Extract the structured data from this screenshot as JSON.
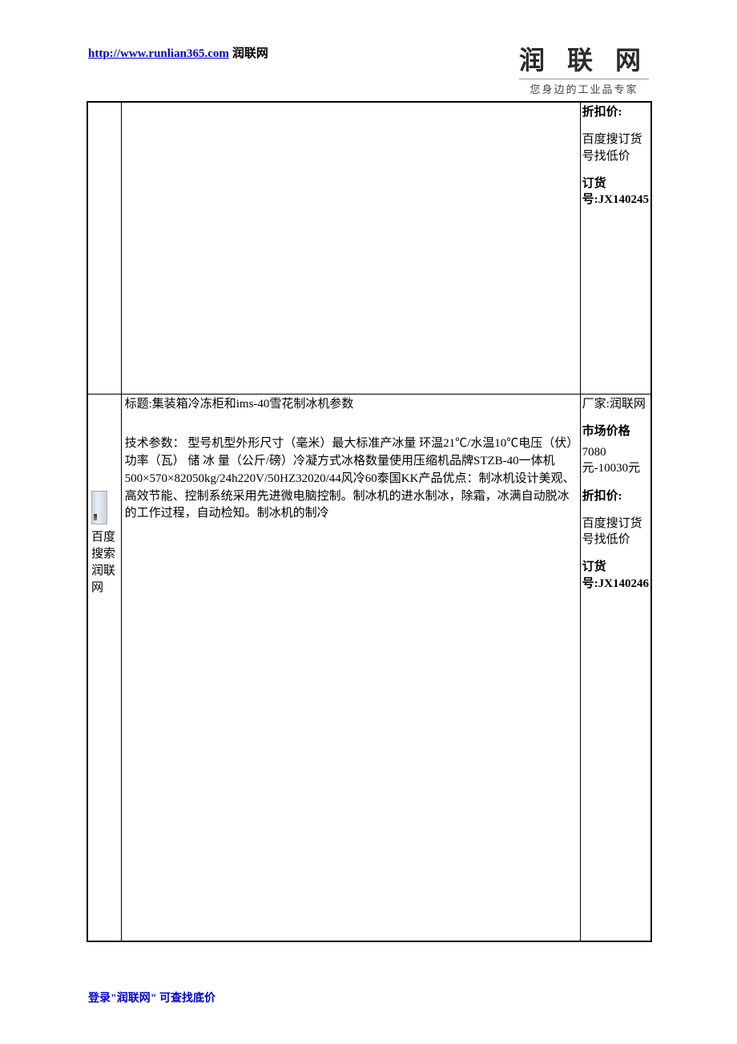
{
  "header": {
    "url": "http://www.runlian365.com",
    "url_suffix": "润联网",
    "logo_main": "润 联 网",
    "logo_sub": "您身边的工业品专家"
  },
  "row1": {
    "left": "",
    "mid": "",
    "right": {
      "discount_label": "折扣价:",
      "search_hint": "百度搜订货号找低价",
      "order_label": "订货号:",
      "order_no": "JX140245"
    }
  },
  "row2": {
    "left_text": "百度搜索润联网",
    "mid_title_prefix": "标题:",
    "mid_title": "集装箱冷冻柜和ims-40雪花制冰机参数",
    "mid_body": "技术参数： 型号机型外形尺寸（毫米）最大标准产冰量 环温21℃/水温10℃电压（伏）功率（瓦） 储 冰 量（公斤/磅）冷凝方式冰格数量使用压缩机品牌STZB-40一体机500×570×82050kg/24h220V/50HZ32020/44风冷60泰国KK产品优点：制冰机设计美观、高效节能、控制系统采用先进微电脑控制。制冰机的进水制冰，除霜，冰满自动脱冰的工作过程，自动检知。制冰机的制冷",
    "right": {
      "mfr_label": "厂家:",
      "mfr_value": "润联网",
      "market_label": "市场价格",
      "market_value": "7080元-10030元",
      "discount_label": "折扣价:",
      "search_hint": "百度搜订货号找低价",
      "order_label": "订货号:",
      "order_no": "JX140246"
    }
  },
  "footer": "登录\"润联网\" 可查找底价"
}
